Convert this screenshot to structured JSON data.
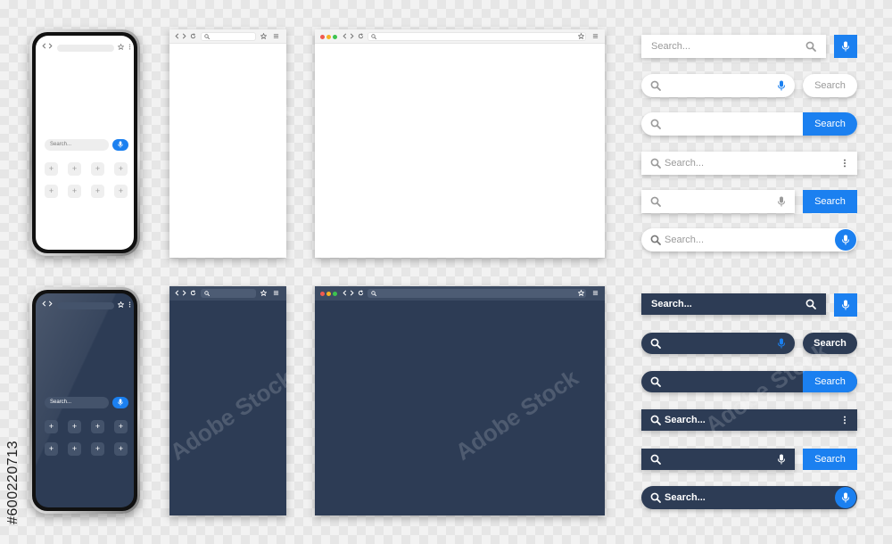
{
  "phones": {
    "light": {
      "search_placeholder": "Search..."
    },
    "dark": {
      "search_placeholder": "Search..."
    },
    "tile_glyph": "+"
  },
  "search_bars": {
    "light": {
      "bar1": {
        "placeholder": "Search..."
      },
      "bar2": {
        "button_label": "Search"
      },
      "bar3": {
        "button_label": "Search"
      },
      "bar4": {
        "placeholder": "Search..."
      },
      "bar5": {
        "button_label": "Search"
      },
      "bar6": {
        "placeholder": "Search..."
      }
    },
    "dark": {
      "bar1": {
        "placeholder": "Search..."
      },
      "bar2": {
        "button_label": "Search"
      },
      "bar3": {
        "button_label": "Search"
      },
      "bar4": {
        "placeholder": "Search..."
      },
      "bar5": {
        "button_label": "Search"
      },
      "bar6": {
        "placeholder": "Search..."
      }
    }
  },
  "watermark": {
    "text": "Adobe Stock",
    "id_text": "#600220713"
  },
  "colors": {
    "accent_blue": "#1b80f0",
    "dark_navy": "#2d3c55",
    "light_surface": "#ffffff",
    "traffic_red": "#f05a4f",
    "traffic_yellow": "#f5b324",
    "traffic_green": "#3dc34f"
  },
  "icons": [
    "chevron-left-icon",
    "chevron-right-icon",
    "reload-icon",
    "search-icon",
    "star-icon",
    "menu-icon",
    "kebab-icon",
    "microphone-icon"
  ]
}
